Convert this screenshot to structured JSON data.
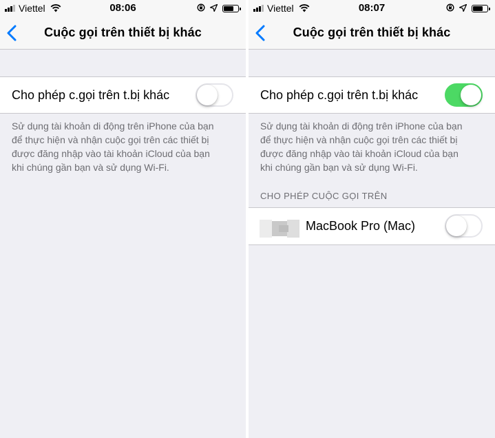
{
  "left": {
    "status": {
      "carrier": "Viettel",
      "time": "08:06"
    },
    "nav": {
      "title": "Cuộc gọi trên thiết bị khác"
    },
    "allow_row": {
      "label": "Cho phép c.gọi trên t.bị khác",
      "enabled": false
    },
    "footer": {
      "line1": "Sử dụng tài khoản di động trên iPhone của bạn",
      "line2": "để thực hiện và nhận cuộc gọi trên các thiết bị",
      "line3": "được đăng nhập vào tài khoản iCloud của bạn",
      "line4": "khi chúng gần bạn và sử dụng Wi-Fi."
    }
  },
  "right": {
    "status": {
      "carrier": "Viettel",
      "time": "08:07"
    },
    "nav": {
      "title": "Cuộc gọi trên thiết bị khác"
    },
    "allow_row": {
      "label": "Cho phép c.gọi trên t.bị khác",
      "enabled": true
    },
    "footer": {
      "line1": "Sử dụng tài khoản di động trên iPhone của bạn",
      "line2": "để thực hiện và nhận cuộc gọi trên các thiết bị",
      "line3": "được đăng nhập vào tài khoản iCloud của bạn",
      "line4": "khi chúng gần bạn và sử dụng Wi-Fi."
    },
    "section_header": "CHO PHÉP CUỘC GỌI TRÊN",
    "device_row": {
      "label": "MacBook Pro (Mac)",
      "enabled": false
    }
  },
  "colors": {
    "accent": "#007aff",
    "switch_on": "#4cd964",
    "background": "#efeff4",
    "footer_text": "#6d6d72"
  },
  "icons": [
    "signal-icon",
    "wifi-icon",
    "orientation-lock-icon",
    "location-icon",
    "battery-icon",
    "back-chevron-icon",
    "device-icon"
  ]
}
